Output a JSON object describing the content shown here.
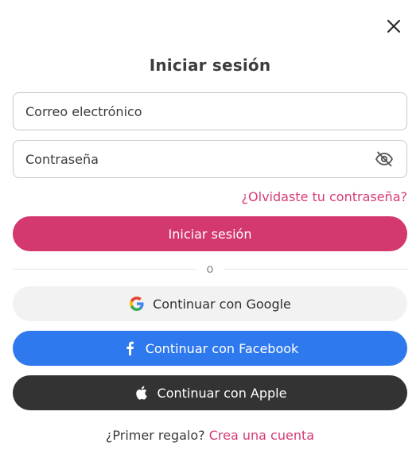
{
  "dialog": {
    "title": "Iniciar sesión",
    "close_icon": "close-icon"
  },
  "form": {
    "email_placeholder": "Correo electrónico",
    "password_placeholder": "Contraseña",
    "password_toggle_icon": "eye-off-icon",
    "forgot_password": "¿Olvidaste tu contraseña?",
    "submit_label": "Iniciar sesión"
  },
  "divider": {
    "label": "o"
  },
  "social": {
    "google_label": "Continuar con Google",
    "facebook_label": "Continuar con Facebook",
    "apple_label": "Continuar con Apple"
  },
  "signup": {
    "prompt": "¿Primer regalo?",
    "link": "Crea una cuenta"
  },
  "colors": {
    "accent": "#d3386f",
    "link": "#d63a78",
    "facebook": "#2f79ee",
    "apple": "#333333",
    "google_bg": "#f2f2f2"
  }
}
